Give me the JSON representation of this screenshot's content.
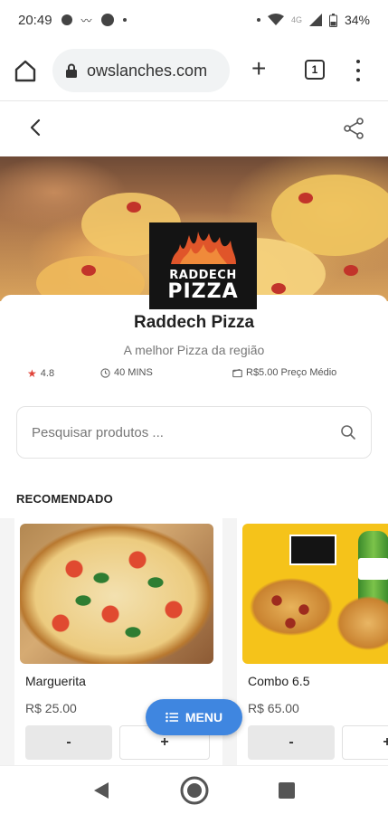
{
  "status_bar": {
    "time": "20:49",
    "network": "4G",
    "battery": "34%"
  },
  "browser": {
    "url": "owslanches.com",
    "tab_count": "1"
  },
  "store": {
    "logo_line1": "RADDECH",
    "logo_line2": "PIZZA",
    "name": "Raddech Pizza",
    "description": "A melhor Pizza da região",
    "rating": "4.8",
    "delivery_time": "40 MINS",
    "avg_price": "R$5.00 Preço Médio"
  },
  "search": {
    "placeholder": "Pesquisar produtos ..."
  },
  "section": {
    "title": "RECOMENDADO"
  },
  "products": [
    {
      "name": "Marguerita",
      "price": "R$ 25.00",
      "minus": "-",
      "plus": "+"
    },
    {
      "name": "Combo 6.5",
      "price": "R$ 65.00",
      "minus": "-",
      "plus": "+"
    }
  ],
  "menu_button": {
    "label": "MENU"
  },
  "colors": {
    "accent": "#3f86e0",
    "star": "#e0443a"
  }
}
